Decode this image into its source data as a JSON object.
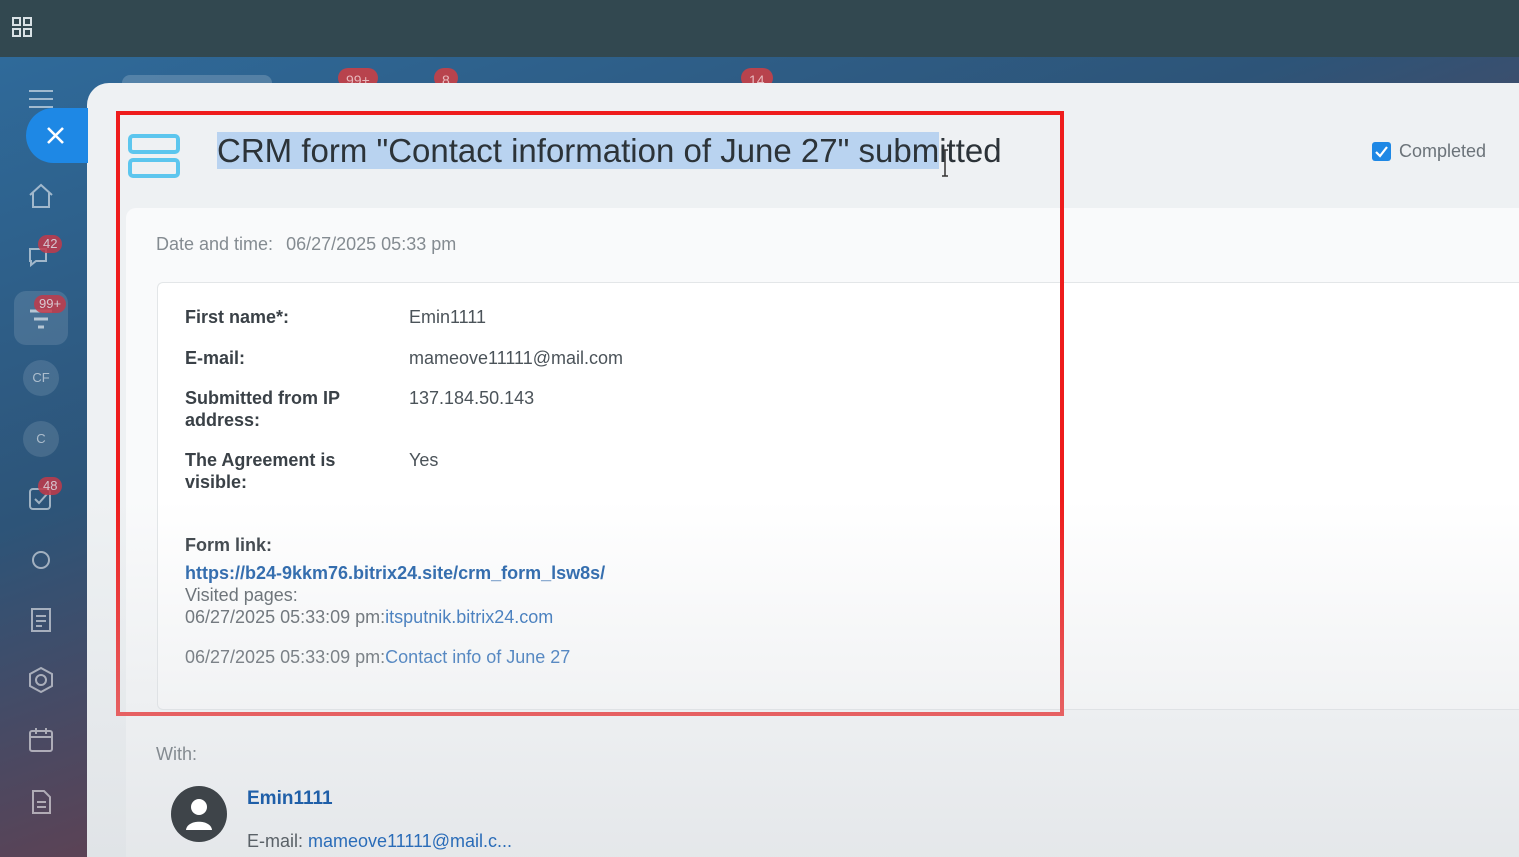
{
  "sidebar": {
    "badges": {
      "chat": "42",
      "crm": "99+",
      "tasks": "48"
    },
    "circles": [
      "CF",
      "C"
    ]
  },
  "top_badges": [
    "99+",
    "8",
    "14"
  ],
  "activity": {
    "title_selected": "CRM form \"Contact information of June 27\" subm",
    "title_rest": "itted",
    "completed_label": "Completed",
    "completed_checked": true,
    "datetime_label": "Date and time:",
    "datetime_value": "06/27/2025 05:33 pm",
    "fields": [
      {
        "label": "First name*:",
        "value": "Emin1111"
      },
      {
        "label": "E-mail:",
        "value": "mameove11111@mail.com"
      },
      {
        "label": "Submitted from IP address:",
        "value": "137.184.50.143"
      },
      {
        "label": "The Agreement is visible:",
        "value": "Yes"
      }
    ],
    "form_link_label": "Form link:",
    "form_link_url": "https://b24-9kkm76.bitrix24.site/crm_form_lsw8s/",
    "visited_pages_label": "Visited pages:",
    "visited": [
      {
        "time": "06/27/2025 05:33:09 pm:",
        "link": "itsputnik.bitrix24.com"
      },
      {
        "time": "06/27/2025 05:33:09 pm:",
        "link": "Contact info of June 27"
      }
    ],
    "with_label": "With:",
    "contact_name": "Emin1111",
    "contact_email_label": "E-mail:",
    "contact_email": "mameove11111@mail.c..."
  },
  "colors": {
    "accent": "#1e88e5",
    "highlight_border": "#ee1c1c",
    "selection": "#b9d3f0",
    "link": "#2a6cb8"
  }
}
